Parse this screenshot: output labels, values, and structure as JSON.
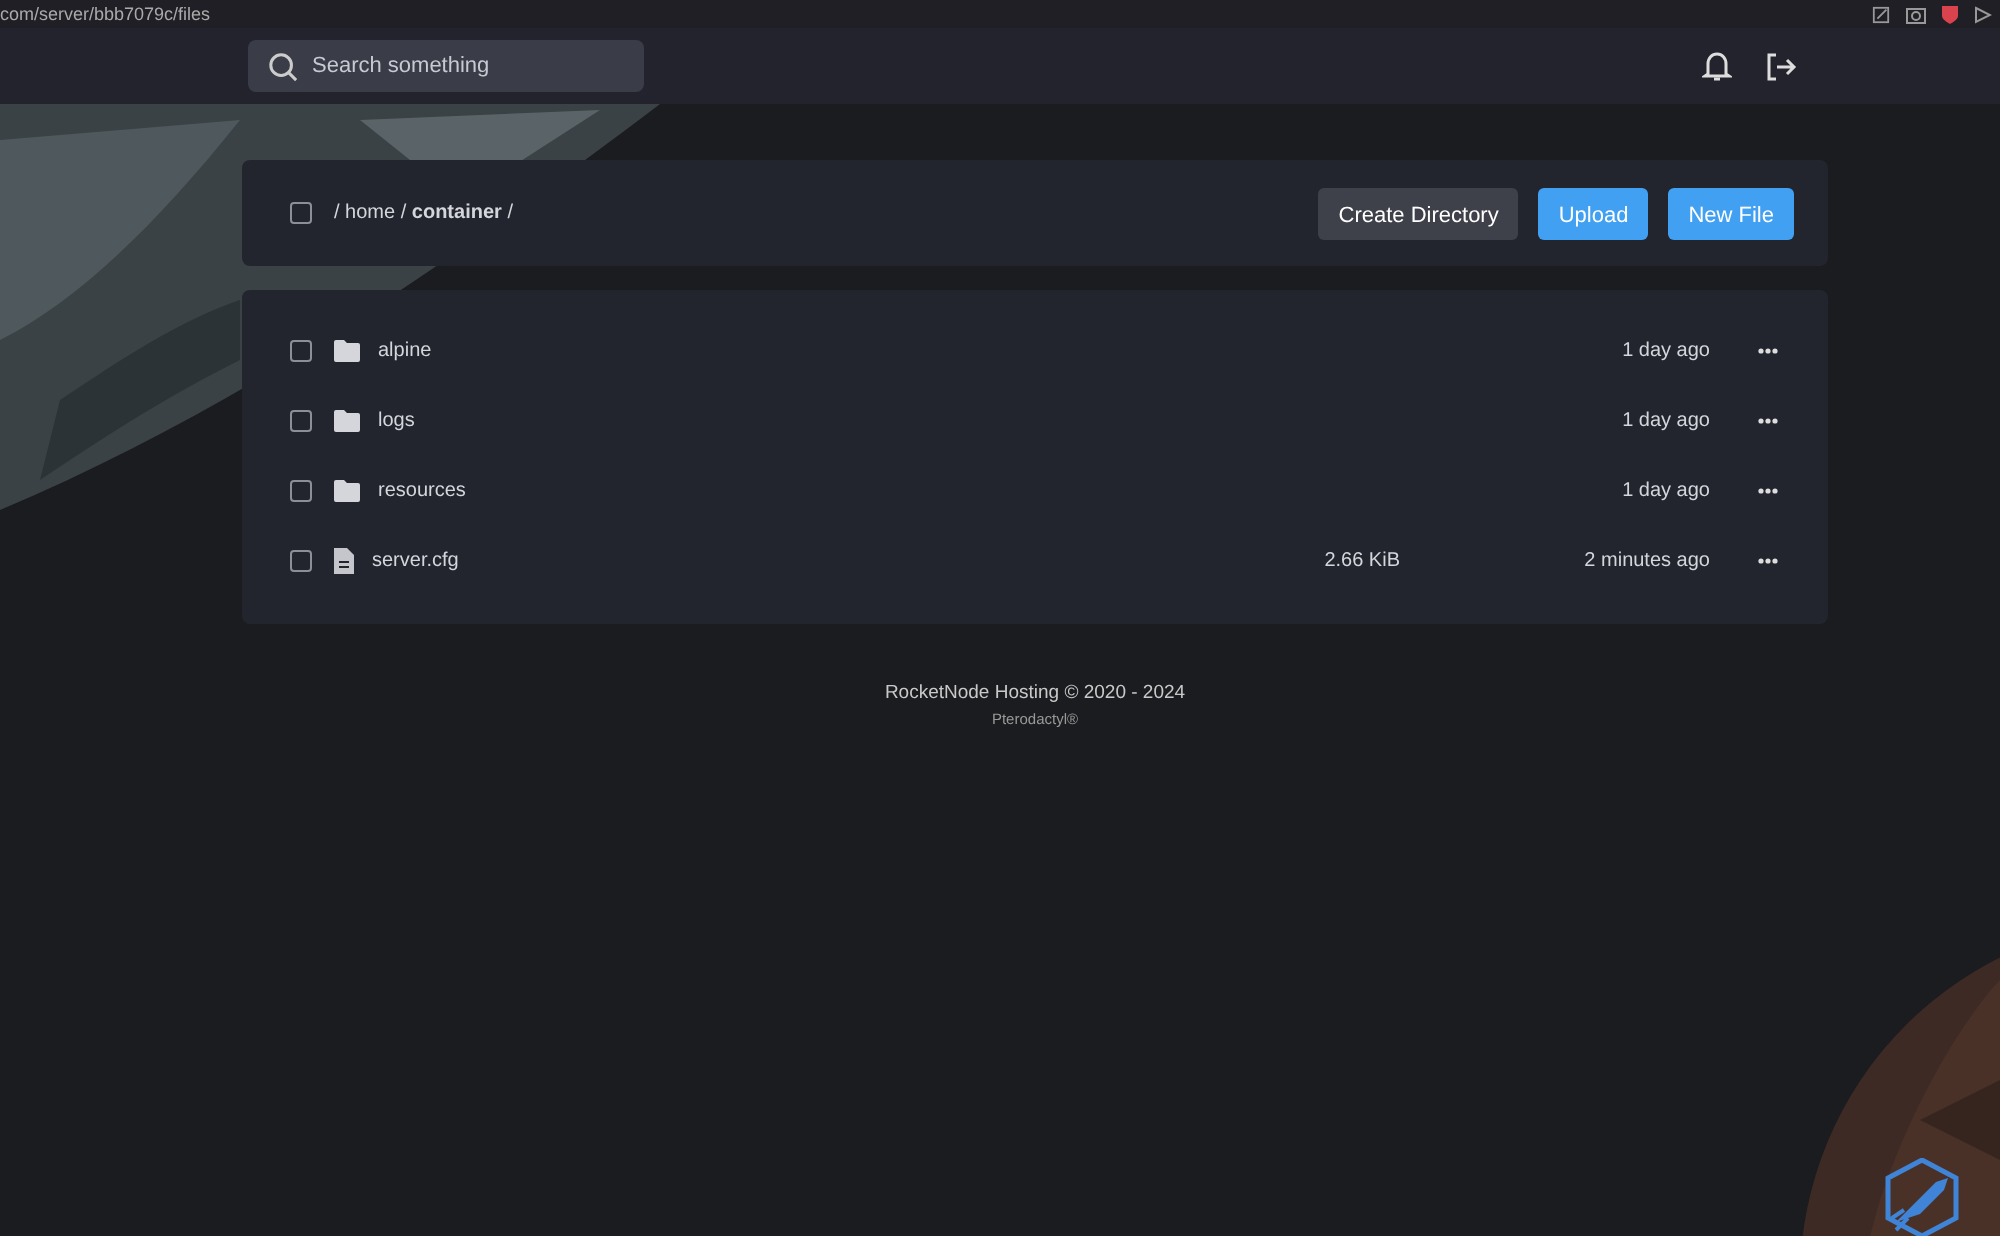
{
  "address_bar": {
    "url": "com/server/bbb7079c/files"
  },
  "header": {
    "search": {
      "placeholder": "Search something"
    }
  },
  "breadcrumb": {
    "checked": false,
    "path": "/ home / **container** /"
  },
  "actions": [
    {
      "label": "Create Directory",
      "kind": "secondary"
    },
    {
      "label": "Upload",
      "kind": "primary"
    },
    {
      "label": "New File",
      "kind": "primary"
    }
  ],
  "files": [
    {
      "name": "alpine",
      "kind": "folder",
      "modified": "1 day ago",
      "checked": false
    },
    {
      "name": "logs",
      "kind": "folder",
      "modified": "1 day ago",
      "checked": false
    },
    {
      "name": "resources",
      "kind": "folder",
      "modified": "1 day ago",
      "checked": false
    },
    {
      "name": "server.cfg",
      "kind": "file",
      "size": "2.66 KiB",
      "modified": "2 minutes ago",
      "checked": false
    }
  ],
  "footer": {
    "copyright": "RocketNode Hosting © 2020 - 2024",
    "powered_by": "Pterodactyl®"
  }
}
